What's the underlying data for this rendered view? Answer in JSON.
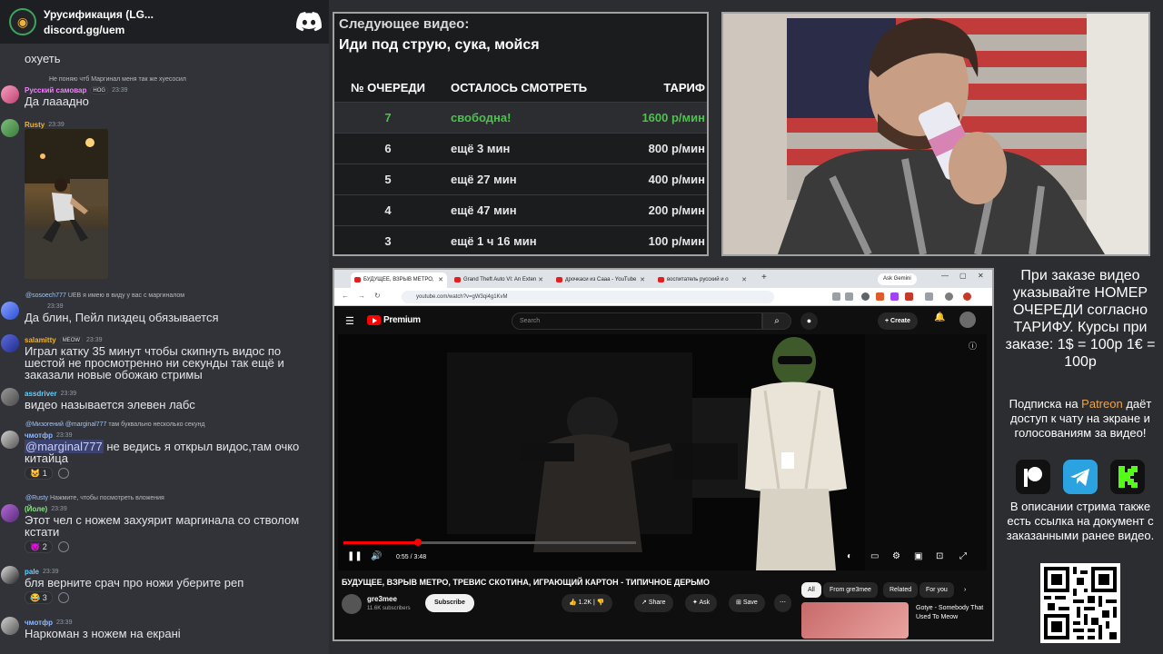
{
  "discord": {
    "server_name": "Урусификация (LG...",
    "server_link": "discord.gg/uem",
    "messages": [
      {
        "text": "охуеть"
      },
      {
        "reply": "Не поняю чтб Маргинал меня так же хуесосил",
        "user": "Русский самовар",
        "badge": "HOG",
        "time": "23:39",
        "text": "Да лааадно"
      },
      {
        "user": "Rusty",
        "time": "23:39"
      },
      {
        "reply_user": "@sosoech777",
        "reply_badge": "UEB",
        "reply": "я имею в виду у вас с маргиналом",
        "time": "23:39",
        "text": "Да блин, Пейл пиздец обязывается"
      },
      {
        "user": "salamitty",
        "badge": "MEOW",
        "time": "23:39",
        "text": "Играл катку 35 минут чтобы скипнуть видос по шестой не просмотренно ни секунды так ещё и заказали новые обожаю стримы"
      },
      {
        "user": "assdriver",
        "time": "23:39",
        "text": "видео называется элевен лабс"
      },
      {
        "reply_user": "@Мизогений",
        "reply_mention": "@marginal777",
        "reply": "там буквально несколько секунд",
        "user": "чмотфр",
        "time": "23:39",
        "mention": "@marginal777",
        "text": " не ведись я открыл видос,там очко китайца",
        "react_count": "1"
      },
      {
        "reply_user": "@Rusty",
        "reply": "Нажмите, чтобы посмотреть вложения",
        "user": "(Йоле)",
        "time": "23:39",
        "text": "Этот чел с ножем захуярит маргинала со стволом кстати",
        "react_count": "2"
      },
      {
        "user": "pale",
        "time": "23:39",
        "text": "бля верните срач про ножи уберите реп",
        "react_count": "3"
      },
      {
        "user": "чмотфр",
        "time": "23:39",
        "text": "Наркоман з ножем на екрані"
      }
    ]
  },
  "queue": {
    "caption": "Следующее видео:",
    "title": "Иди под струю, сука, мойся",
    "headers": [
      "№ ОЧЕРЕДИ",
      "ОСТАЛОСЬ СМОТРЕТЬ",
      "ТАРИФ"
    ],
    "rows": [
      {
        "num": "7",
        "left": "свободна!",
        "rate": "1600 р/мин"
      },
      {
        "num": "6",
        "left": "ещё 3 мин",
        "rate": "800 р/мин"
      },
      {
        "num": "5",
        "left": "ещё 27 мин",
        "rate": "400 р/мин"
      },
      {
        "num": "4",
        "left": "ещё 47 мин",
        "rate": "200 р/мин"
      },
      {
        "num": "3",
        "left": "ещё 1 ч 16 мин",
        "rate": "100 р/мин"
      }
    ]
  },
  "browser": {
    "tabs": [
      "БУДУЩЕЕ, ВЗРЫВ МЕТРО,",
      "Grand Theft Auto VI: An Exten",
      "дрочкаси из Сааа - YouTube",
      "воспитатель русский и о"
    ],
    "ask_gemini": "Ask Gemini",
    "url": "youtube.com/watch?v=gW3qi4g1KvM",
    "yt_brand": "Premium",
    "search_placeholder": "Search",
    "create_label": "Create",
    "time_display": "0:55 / 3:48",
    "progress": 0.255,
    "video_title": "БУДУЩЕЕ, ВЗРЫВ МЕТРО, ТРЕВИС СКОТИНА, ИГРАЮЩИЙ КАРТОН - ТИПИЧНОЕ ДЕРЬМО",
    "channel_name": "gre3mee",
    "channel_subs": "11.6K subscribers",
    "subscribe_label": "Subscribe",
    "likes": "1.2K",
    "share_label": "Share",
    "ask_label": "Ask",
    "save_label": "Save",
    "chips": [
      "All",
      "From gre3mee",
      "Related",
      "For you"
    ],
    "rec_title": "Gotye - Somebody That Used To Meow"
  },
  "info": {
    "main": "При заказе видео указывайте НОМЕР ОЧЕРЕДИ согласно ТАРИФУ. Курсы при заказе: 1$ = 100р 1€ = 100р",
    "sub_pre": "Подписка на ",
    "sub_brand": "Patreon",
    "sub_post": " даёт доступ к чату на экране и голосованиям за видео!",
    "desc": "В описании стрима также есть ссылка на документ с заказанными ранее видео."
  },
  "colors": {
    "queue_free": "#4fc14f",
    "patreon": "#f0a34a",
    "telegram": "#2aa3e0",
    "kick": "#53fc18",
    "yt_red": "#ff0000"
  }
}
